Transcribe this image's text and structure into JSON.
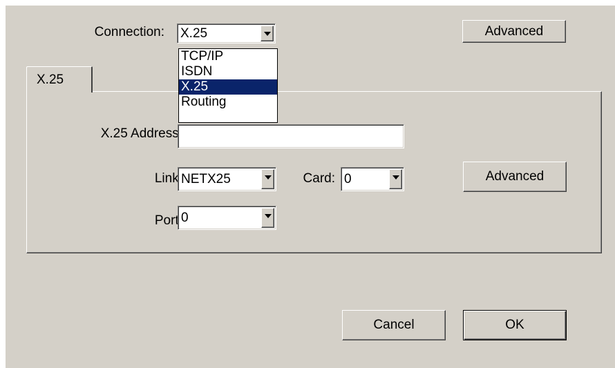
{
  "connection": {
    "label": "Connection:",
    "value": "X.25",
    "options": [
      "TCP/IP",
      "ISDN",
      "X.25",
      "Routing"
    ],
    "selected_index": 2
  },
  "top_advanced_label": "Advanced",
  "tab": {
    "label": "X.25"
  },
  "panel": {
    "address_label": "X.25 Address:",
    "address_value": "",
    "link_label": "Link:",
    "link_value": "NETX25",
    "card_label": "Card:",
    "card_value": "0",
    "port_label": "Port:",
    "port_value": "0",
    "advanced_label": "Advanced"
  },
  "footer": {
    "cancel_label": "Cancel",
    "ok_label": "OK"
  },
  "colors": {
    "face": "#d4d0c8",
    "selection": "#0a246a"
  }
}
